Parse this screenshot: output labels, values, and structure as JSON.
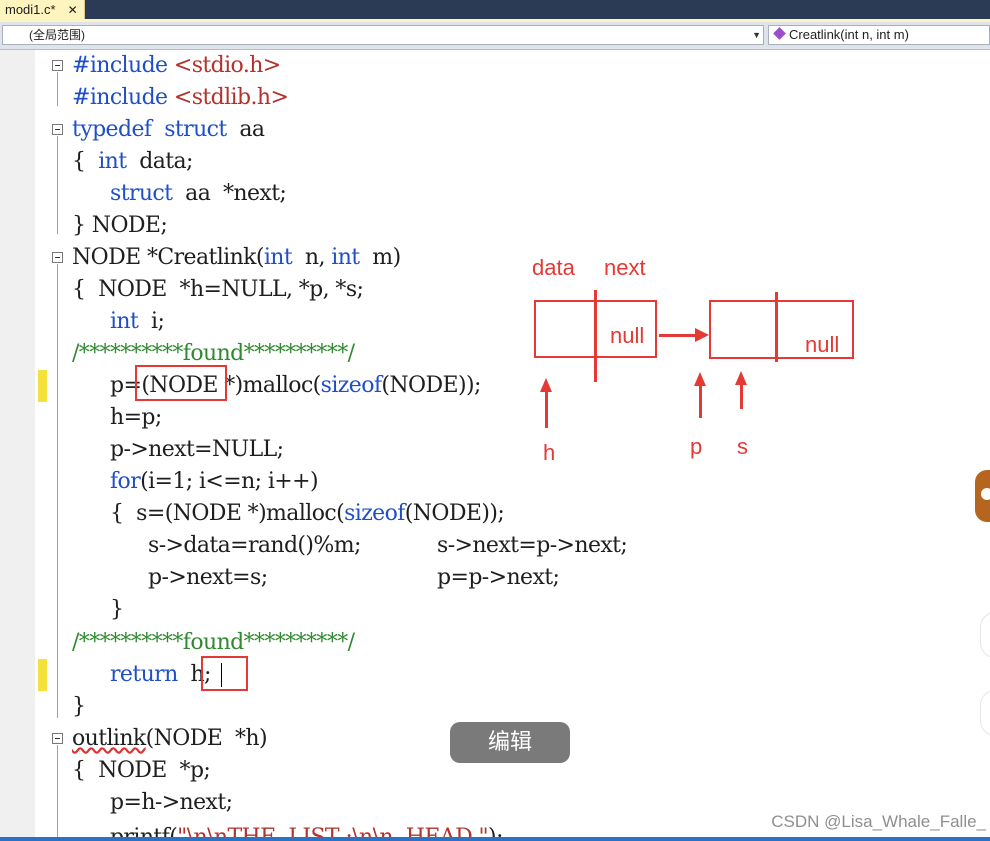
{
  "tab": {
    "title": "modi1.c*",
    "close": "✕"
  },
  "navbar": {
    "scope": "(全局范围)",
    "member": "Creatlink(int n, int m)"
  },
  "code": {
    "l1": {
      "a": "#include ",
      "b": "<stdio.h>"
    },
    "l2": {
      "a": "#include ",
      "b": "<stdlib.h>"
    },
    "l3": {
      "kw1": "typedef",
      "kw2": "struct",
      "rest": "aa"
    },
    "l4": {
      "a": "{  ",
      "kw": "int",
      "rest": "  data;"
    },
    "l5": {
      "kw": "struct",
      "rest": "  aa  *next;"
    },
    "l6": {
      "a": "} NODE;"
    },
    "l7": {
      "a": "NODE *Creatlink(",
      "kw1": "int",
      "b": "  n, ",
      "kw2": "int",
      "c": "  m)"
    },
    "l8": {
      "a": "{  NODE  *h=NULL, *p, *s;"
    },
    "l9": {
      "kw": "int",
      "rest": "  i;"
    },
    "l10": {
      "a": "/**********found**********/"
    },
    "l11": {
      "a": "p=(NODE *)malloc(",
      "kw": "sizeof",
      "b": "(NODE));"
    },
    "l12": {
      "a": "h=p;"
    },
    "l13": {
      "a": "p->next=NULL;"
    },
    "l14": {
      "kw": "for",
      "rest": "(i=1; i<=n; i++)"
    },
    "l15": {
      "a": "{  s=(NODE *)malloc(",
      "kw": "sizeof",
      "b": "(NODE));"
    },
    "l16": {
      "a": "s->data=rand()%m;",
      "b": "s->next=p->next;"
    },
    "l17": {
      "a": "p->next=s;",
      "b": "p=p->next;"
    },
    "l18": {
      "a": "}"
    },
    "l19": {
      "a": "/**********found**********/"
    },
    "l20": {
      "kw": "return",
      "rest": "h;"
    },
    "l21": {
      "a": "}"
    },
    "l22": {
      "fn": "outlink",
      "rest": "(NODE  *h)"
    },
    "l23": {
      "a": "{  NODE  *p;"
    },
    "l24": {
      "a": "p=h->next;"
    },
    "l25": {
      "a": "printf(",
      "s": "\"\\n\\nTHE  LIST :\\n\\n  HEAD \"",
      "b": ");"
    }
  },
  "diagram": {
    "label_data": "data",
    "label_next": "next",
    "null1": "null",
    "null2": "null",
    "ptr_h": "h",
    "ptr_p": "p",
    "ptr_s": "s",
    "color": "#e53935"
  },
  "edit_button": "编辑",
  "watermark": "CSDN @Lisa_Whale_Falle_",
  "colors": {
    "keyword": "#1f4fc8",
    "string": "#b4312c",
    "comment": "#2f8a2f",
    "tab_bg": "#fdf4bf",
    "tab_bar": "#2b3a55"
  }
}
